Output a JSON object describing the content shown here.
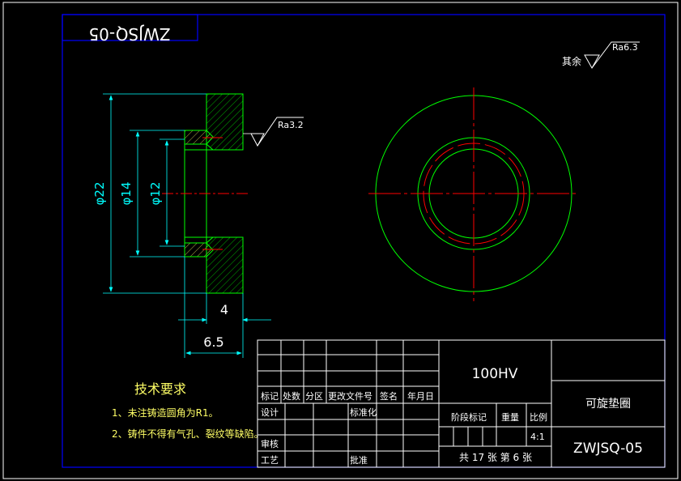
{
  "title_block_top": {
    "mirrored_code": "ZWJSQ-05"
  },
  "surface_finish": {
    "general_label": "其余",
    "general_roughness": "Ra6.3",
    "local_roughness": "Ra3.2"
  },
  "dimensions": {
    "outer_diameter": "φ22",
    "middle_diameter": "φ14",
    "inner_diameter": "φ12",
    "thickness": "4",
    "total_width": "6.5"
  },
  "technical_requirements": {
    "heading": "技术要求",
    "items": [
      "1、未注铸造圆角为R1。",
      "2、铸件不得有气孔、裂纹等缺陷。"
    ]
  },
  "title_block": {
    "material": "100HV",
    "part_name": "可旋垫圈",
    "drawing_number": "ZWJSQ-05",
    "header_labels": [
      "标记",
      "处数",
      "分区",
      "更改文件号",
      "签名",
      "年月日"
    ],
    "design_label": "设计",
    "standardize_label": "标准化",
    "stage_mark_label": "阶段标记",
    "weight_label": "重量",
    "scale_label": "比例",
    "scale_value": "4:1",
    "review_label": "审核",
    "process_label": "工艺",
    "approve_label": "批准",
    "sheet_info": "共 17 张 第 6 张"
  },
  "colors": {
    "background": "#000000",
    "frame": "#0000ff",
    "section_outline": "#00ff00",
    "dimension": "#00ffff",
    "center_line": "#ff0000",
    "title_text": "#ffffff",
    "annotation_text": "#ffff66"
  }
}
